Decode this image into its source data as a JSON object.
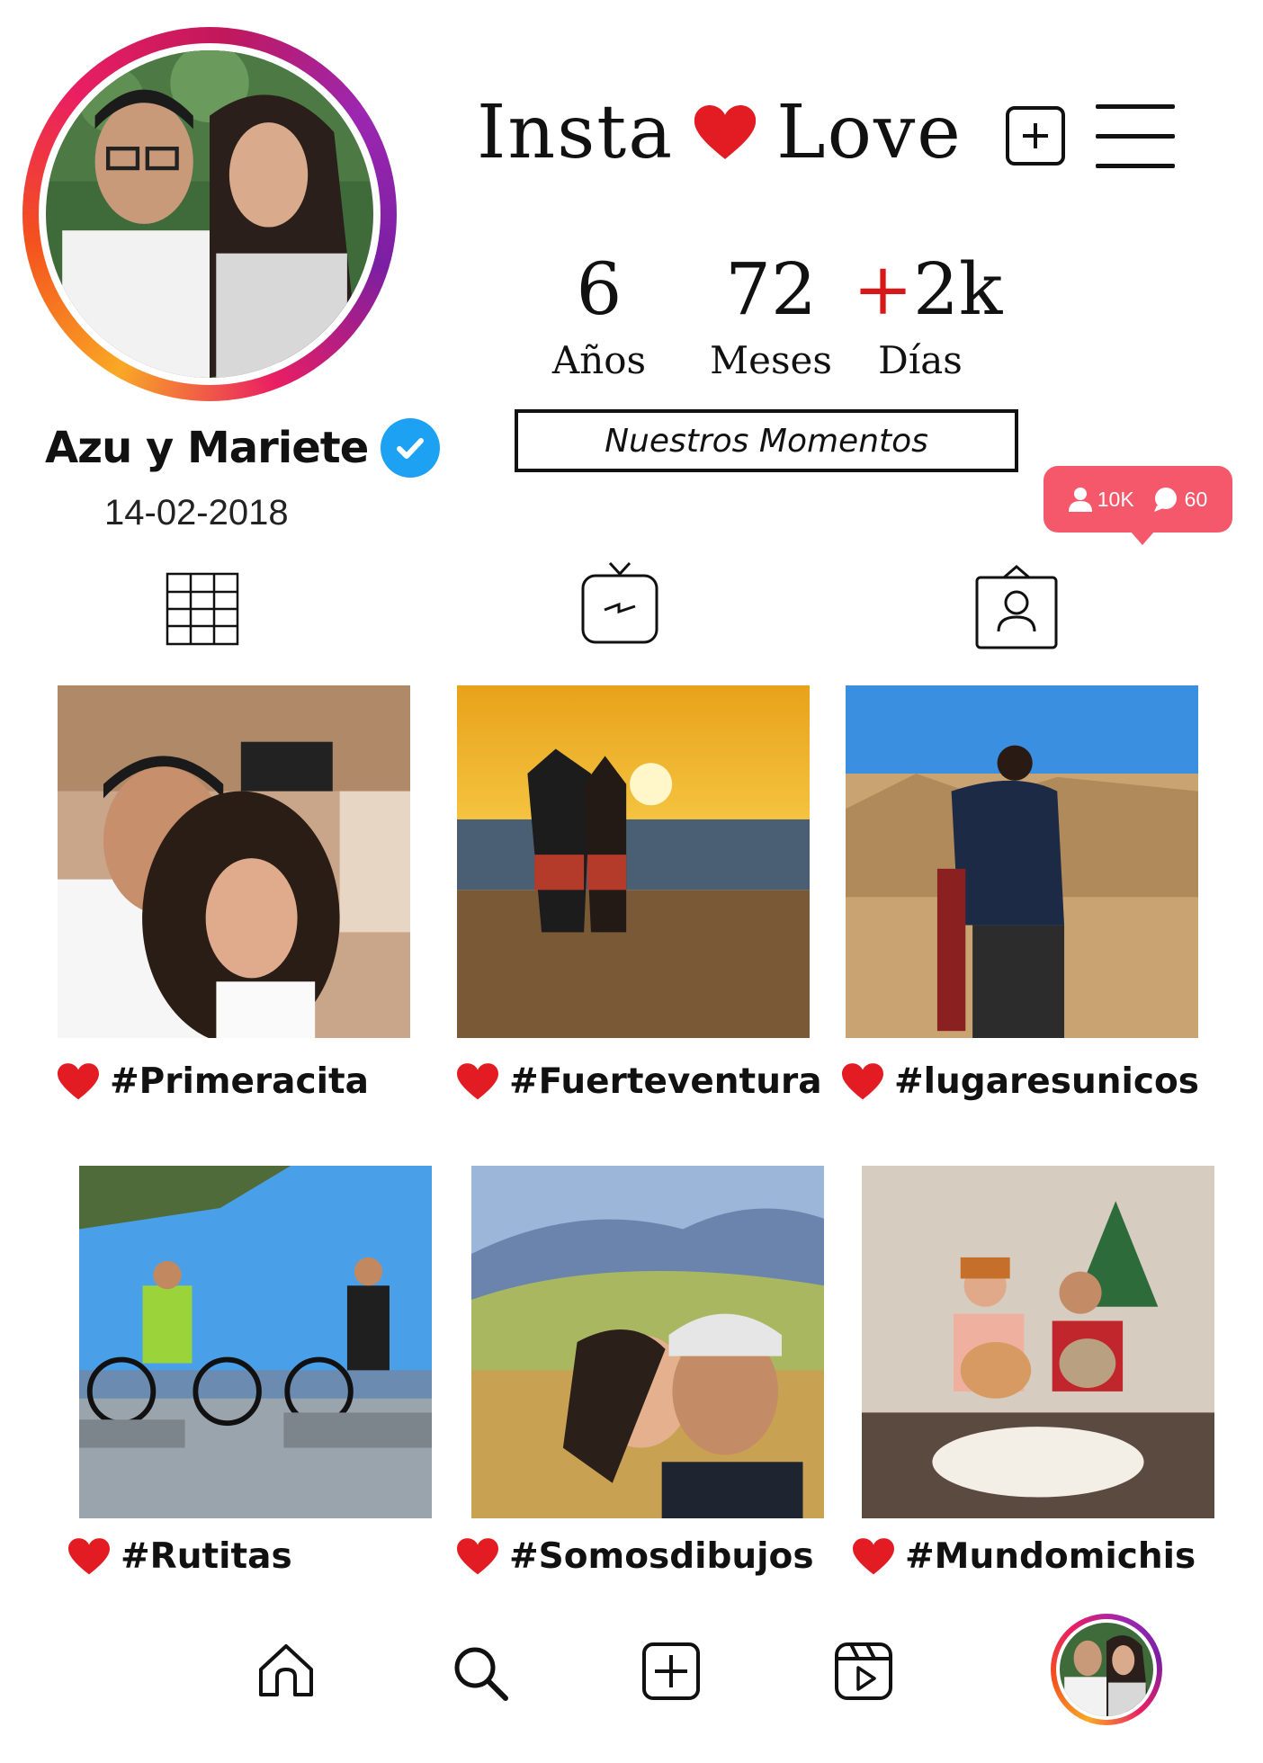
{
  "header": {
    "title_left": "Insta",
    "title_right": "Love",
    "add_icon": "plus-square-icon",
    "menu_icon": "hamburger-menu-icon"
  },
  "profile": {
    "name": "Azu y Mariete",
    "date": "14-02-2018",
    "verified_icon": "verified-check-icon"
  },
  "stats": [
    {
      "prefix": "",
      "value": "6",
      "label": "Años"
    },
    {
      "prefix": "",
      "value": "72",
      "label": "Meses"
    },
    {
      "prefix": "+",
      "value": "2k",
      "label": "Días"
    }
  ],
  "moments_button": "Nuestros Momentos",
  "notification": {
    "followers": "10K",
    "comments": "60",
    "color": "#f5586a"
  },
  "tabs": [
    {
      "icon": "grid-icon"
    },
    {
      "icon": "igtv-icon"
    },
    {
      "icon": "tagged-user-icon"
    }
  ],
  "posts": [
    {
      "caption": "#Primeracita"
    },
    {
      "caption": "#Fuerteventura"
    },
    {
      "caption": "#lugaresunicos"
    },
    {
      "caption": "#Rutitas"
    },
    {
      "caption": "#Somosdibujos"
    },
    {
      "caption": "#Mundomichis"
    }
  ],
  "bottom_nav": [
    {
      "icon": "home-icon"
    },
    {
      "icon": "search-icon"
    },
    {
      "icon": "add-post-icon"
    },
    {
      "icon": "reels-icon"
    },
    {
      "icon": "profile-avatar-icon"
    }
  ],
  "colors": {
    "heart": "#e31b23",
    "verified": "#1da1f2"
  }
}
